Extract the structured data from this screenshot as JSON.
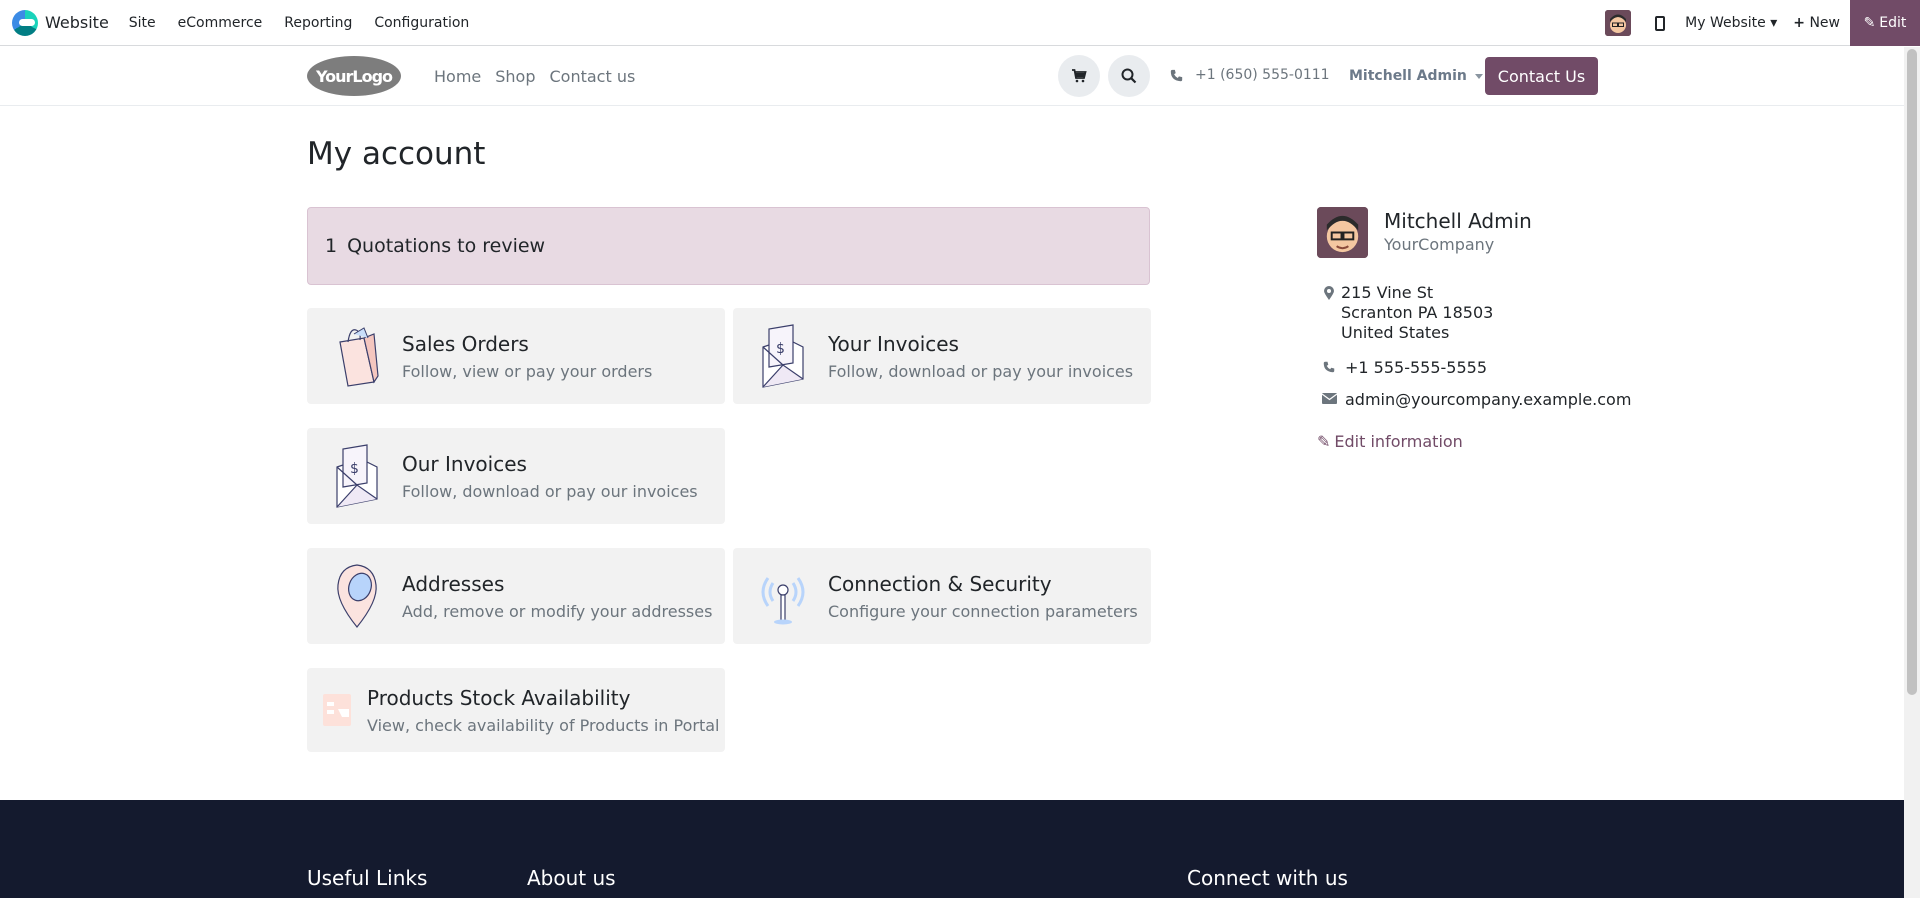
{
  "topbar": {
    "app_name": "Website",
    "menu": [
      "Site",
      "eCommerce",
      "Reporting",
      "Configuration"
    ],
    "my_website": "My Website",
    "new_label": "New",
    "edit_label": "Edit"
  },
  "header": {
    "logo_text": "YourLogo",
    "nav": [
      "Home",
      "Shop",
      "Contact us"
    ],
    "phone": "+1 (650) 555-0111",
    "user": "Mitchell Admin",
    "contact_button": "Contact Us"
  },
  "main": {
    "title": "My account",
    "alert": {
      "count": "1",
      "label": "Quotations to review"
    },
    "cards": [
      {
        "title": "Sales Orders",
        "desc": "Follow, view or pay your orders",
        "icon": "shopping-bag-icon"
      },
      {
        "title": "Your Invoices",
        "desc": "Follow, download or pay your invoices",
        "icon": "invoice-envelope-icon"
      },
      {
        "title": "Our Invoices",
        "desc": "Follow, download or pay our invoices",
        "icon": "invoice-envelope-icon"
      },
      {
        "title": "Addresses",
        "desc": "Add, remove or modify your addresses",
        "icon": "map-pin-icon"
      },
      {
        "title": "Connection & Security",
        "desc": "Configure your connection parameters",
        "icon": "antenna-icon"
      },
      {
        "title": "Products Stock Availability",
        "desc": "View, check availability of Products in Portal",
        "icon": "stock-icon"
      }
    ]
  },
  "sidebar": {
    "name": "Mitchell Admin",
    "company": "YourCompany",
    "address_line1": "215 Vine St",
    "address_line2": "Scranton PA 18503",
    "address_line3": "United States",
    "phone": "+1 555-555-5555",
    "email": "admin@yourcompany.example.com",
    "edit_label": "Edit information"
  },
  "footer": {
    "useful_links": "Useful Links",
    "about_us": "About us",
    "connect": "Connect with us"
  },
  "colors": {
    "accent": "#714b67",
    "alert_bg": "#e8dae3",
    "card_bg": "#f2f2f2",
    "footer_bg": "#141a2e"
  }
}
